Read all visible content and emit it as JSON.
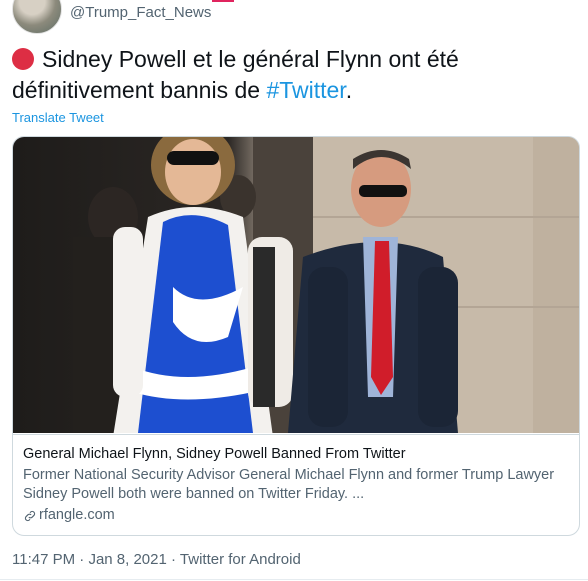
{
  "header": {
    "handle": "@Trump_Fact_News"
  },
  "tweet": {
    "text_part1": "Sidney Powell et le général Flynn ont été définitivement bannis de ",
    "hashtag": "#Twitter",
    "text_part2": ".",
    "translate_label": "Translate Tweet"
  },
  "card": {
    "title": "General Michael Flynn, Sidney Powell Banned From Twitter",
    "description": "Former National Security Advisor General Michael Flynn and former Trump Lawyer Sidney Powell both were banned on Twitter Friday. ...",
    "domain": "rfangle.com"
  },
  "meta": {
    "time": "11:47 PM",
    "sep1": " · ",
    "date": "Jan 8, 2021",
    "sep2": " · ",
    "source": "Twitter for Android"
  },
  "colors": {
    "link": "#1b95e0",
    "red_circle": "#dd2e44",
    "secondary_text": "#536471"
  },
  "icons": {
    "red_circle": "red-circle-emoji",
    "link": "link-icon"
  }
}
